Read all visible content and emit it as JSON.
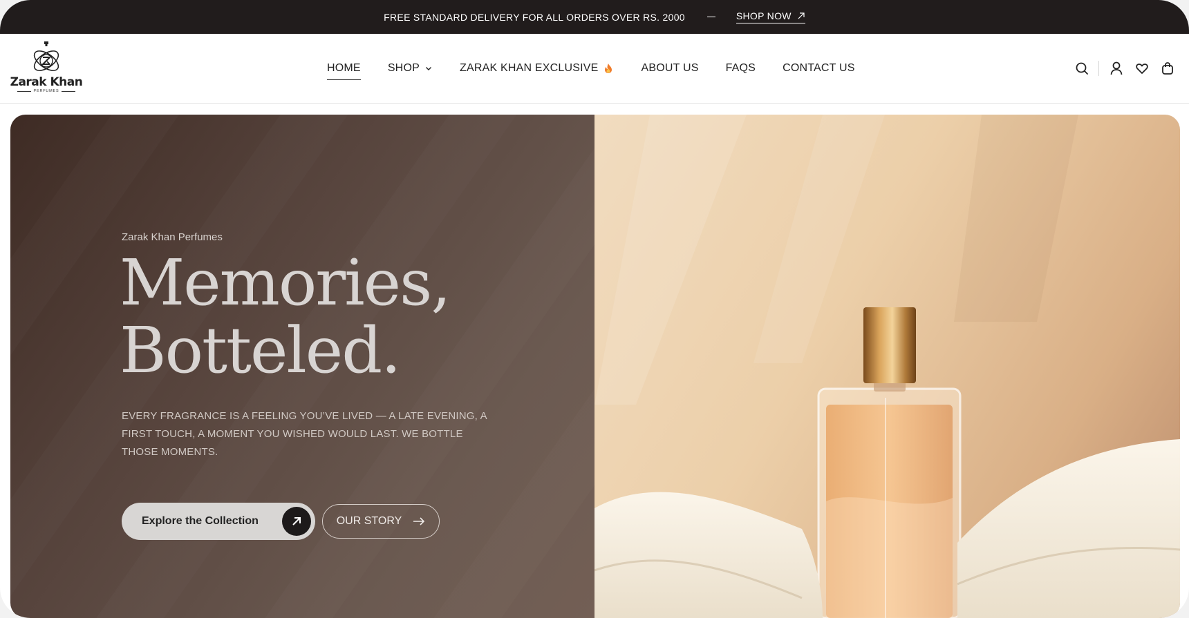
{
  "announcement": {
    "message": "FREE STANDARD DELIVERY FOR ALL ORDERS OVER RS. 2000",
    "link_label": "SHOP NOW"
  },
  "logo": {
    "brand": "Zarak Khan",
    "tagline": "PERFUMES"
  },
  "nav": {
    "items": [
      {
        "label": "HOME",
        "active": true
      },
      {
        "label": "SHOP",
        "has_dropdown": true
      },
      {
        "label": "ZARAK KHAN EXCLUSIVE",
        "icon": "flame-icon"
      },
      {
        "label": "ABOUT US"
      },
      {
        "label": "FAQS"
      },
      {
        "label": "CONTACT US"
      }
    ]
  },
  "header_icons": [
    "search-icon",
    "account-icon",
    "wishlist-heart-icon",
    "cart-bag-icon"
  ],
  "hero": {
    "eyebrow": "Zarak Khan Perfumes",
    "headline_line1": "Memories,",
    "headline_line2": "Botteled.",
    "description": "EVERY FRAGRANCE IS A FEELING YOU’VE LIVED — A LATE EVENING, A FIRST TOUCH, A MOMENT YOU WISHED WOULD LAST. WE BOTTLE THOSE MOMENTS.",
    "primary_cta": "Explore the Collection",
    "secondary_cta": "OUR STORY"
  },
  "colors": {
    "topbar_bg": "#211c1c",
    "hero_left_bg": "#5a463e",
    "accent_dark": "#1d1a1a",
    "hero_right_bg": "#eccfa9"
  }
}
